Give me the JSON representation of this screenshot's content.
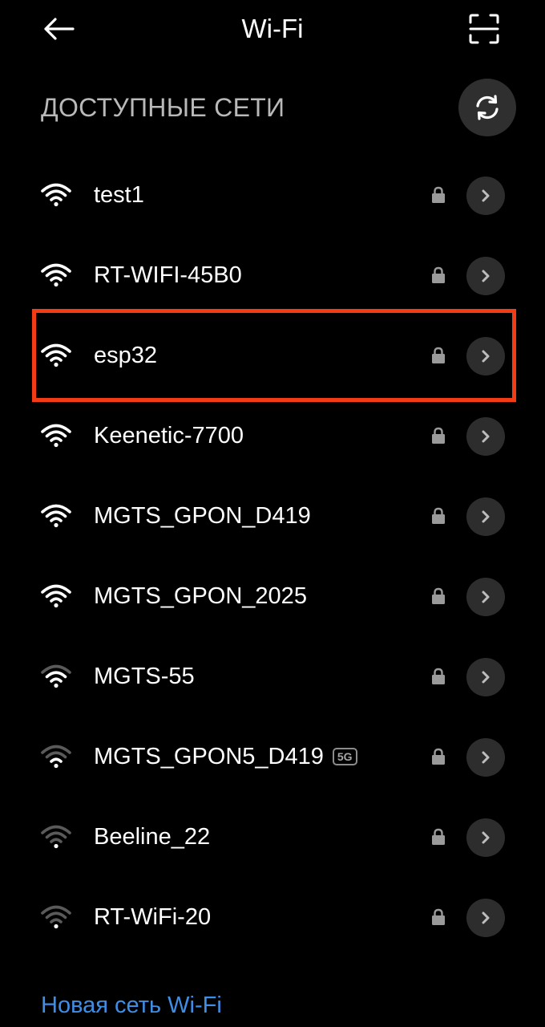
{
  "header": {
    "title": "Wi-Fi",
    "back_icon": "arrow-left-icon",
    "scan_icon": "qr-scan-icon"
  },
  "section": {
    "title": "ДОСТУПНЫЕ СЕТИ",
    "refresh_icon": "refresh-icon"
  },
  "networks": [
    {
      "ssid": "test1",
      "secured": true,
      "signal_level": 4,
      "band": ""
    },
    {
      "ssid": "RT-WIFI-45B0",
      "secured": true,
      "signal_level": 4,
      "band": ""
    },
    {
      "ssid": "esp32",
      "secured": true,
      "signal_level": 4,
      "band": "",
      "highlighted": true
    },
    {
      "ssid": "Keenetic-7700",
      "secured": true,
      "signal_level": 4,
      "band": ""
    },
    {
      "ssid": "MGTS_GPON_D419",
      "secured": true,
      "signal_level": 4,
      "band": ""
    },
    {
      "ssid": "MGTS_GPON_2025",
      "secured": true,
      "signal_level": 4,
      "band": ""
    },
    {
      "ssid": "MGTS-55",
      "secured": true,
      "signal_level": 3,
      "band": ""
    },
    {
      "ssid": "MGTS_GPON5_D419",
      "secured": true,
      "signal_level": 2,
      "band": "5G"
    },
    {
      "ssid": "Beeline_22",
      "secured": true,
      "signal_level": 1,
      "band": ""
    },
    {
      "ssid": "RT-WiFi-20",
      "secured": true,
      "signal_level": 1,
      "band": ""
    }
  ],
  "footer": {
    "add_network_label": "Новая сеть Wi-Fi"
  },
  "colors": {
    "background": "#000000",
    "text": "#ffffff",
    "muted_text": "#b9b9b9",
    "link": "#3f8ee6",
    "highlight": "#f13c16",
    "button_bg": "#2d2d2d"
  }
}
